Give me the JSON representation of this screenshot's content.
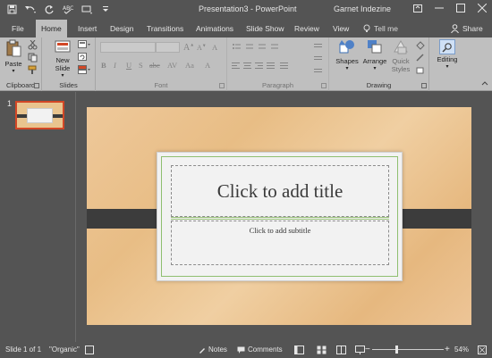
{
  "window": {
    "title": "Presentation3 - PowerPoint",
    "user": "Garnet Indezine"
  },
  "quick_access": {
    "icons": [
      "save-icon",
      "undo-icon",
      "redo-icon",
      "spelling-icon",
      "customize-icon"
    ]
  },
  "tabs": [
    {
      "label": "File",
      "active": false
    },
    {
      "label": "Home",
      "active": true
    },
    {
      "label": "Insert",
      "active": false
    },
    {
      "label": "Design",
      "active": false
    },
    {
      "label": "Transitions",
      "active": false
    },
    {
      "label": "Animations",
      "active": false
    },
    {
      "label": "Slide Show",
      "active": false
    },
    {
      "label": "Review",
      "active": false
    },
    {
      "label": "View",
      "active": false
    }
  ],
  "tell_me": "Tell me",
  "share": "Share",
  "ribbon": {
    "clipboard": {
      "label": "Clipboard",
      "paste": "Paste"
    },
    "slides": {
      "label": "Slides",
      "new_slide_line1": "New",
      "new_slide_line2": "Slide"
    },
    "font": {
      "label": "Font",
      "bold": "B",
      "italic": "I",
      "underline": "U",
      "strike": "S",
      "abc": "abc"
    },
    "paragraph": {
      "label": "Paragraph"
    },
    "drawing": {
      "label": "Drawing",
      "shapes": "Shapes",
      "arrange": "Arrange",
      "quick_styles_line1": "Quick",
      "quick_styles_line2": "Styles"
    },
    "editing": {
      "label": "Editing"
    }
  },
  "thumbnail": {
    "number": "1"
  },
  "slide": {
    "title_placeholder": "Click to add title",
    "subtitle_placeholder": "Click to add subtitle"
  },
  "status": {
    "slide_count": "Slide 1 of 1",
    "theme": "\"Organic\"",
    "notes": "Notes",
    "comments": "Comments",
    "zoom": "54%"
  },
  "colors": {
    "ribbon_bg": "#bfbfbf",
    "chrome_bg": "#545454",
    "accent": "#d24726"
  }
}
